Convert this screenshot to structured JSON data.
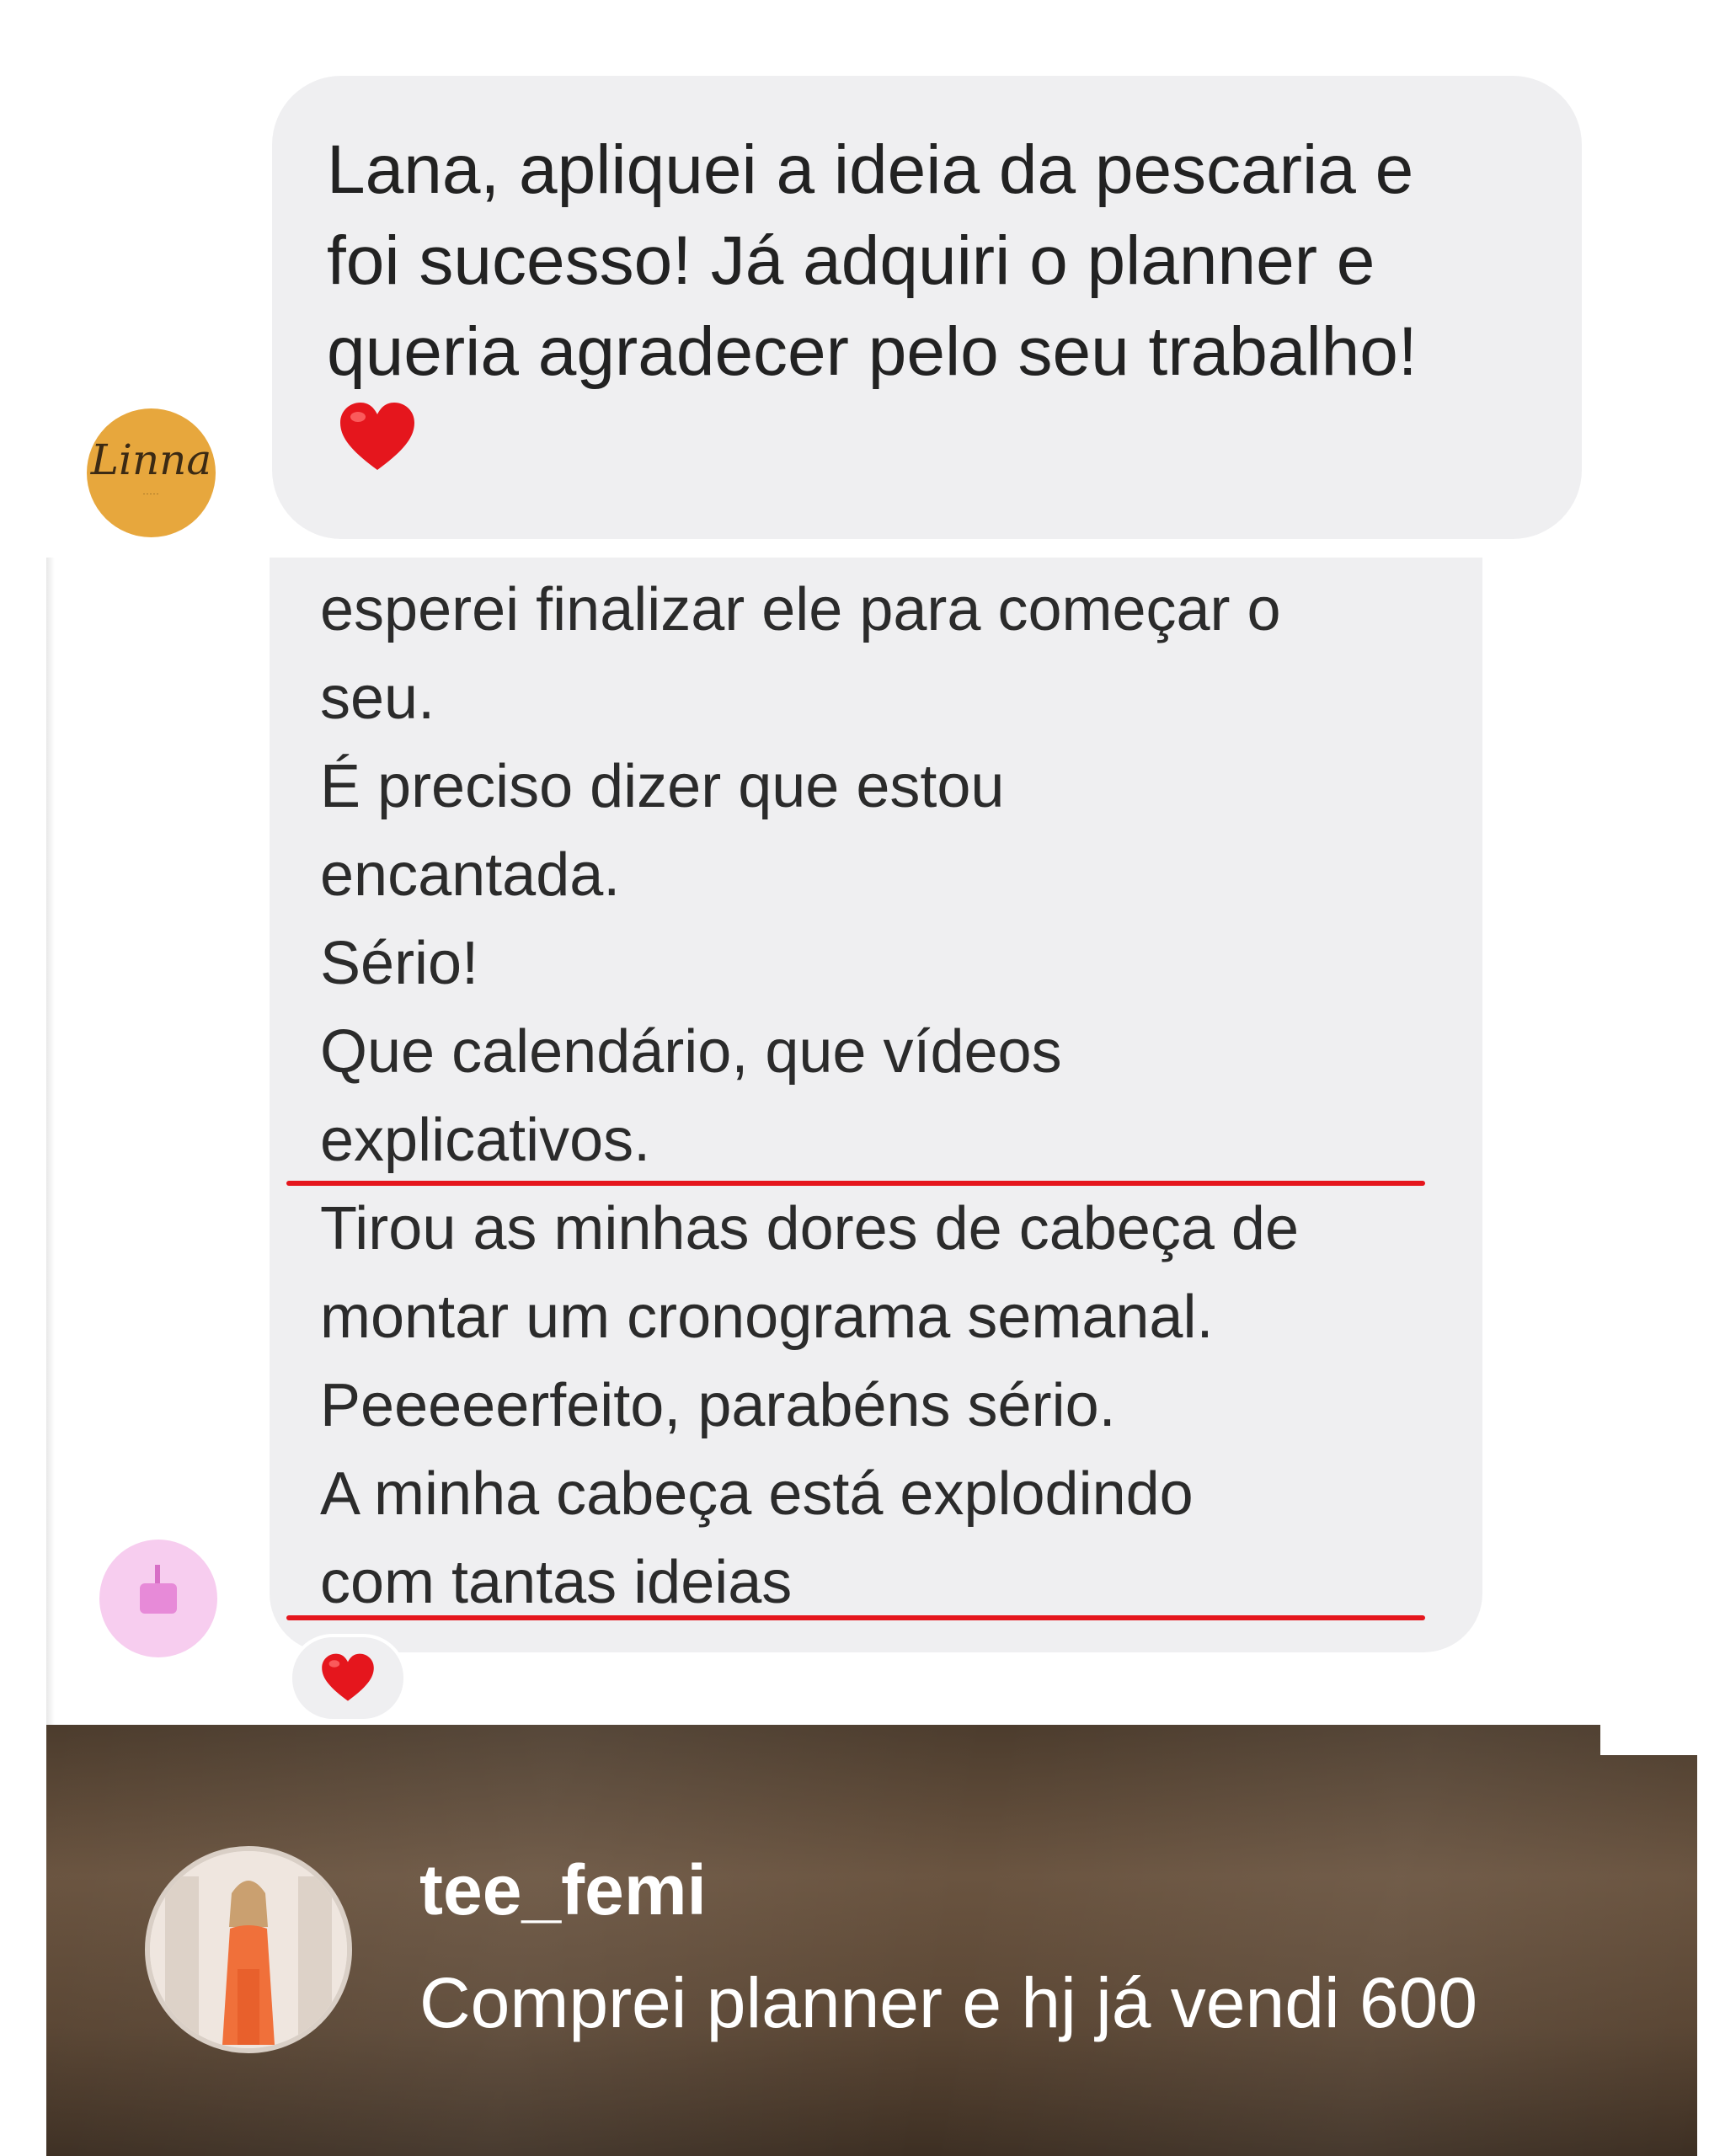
{
  "message1": {
    "lines": [
      "Lana, apliquei a ideia da pescaria e",
      "foi sucesso! Já adquiri o planner e",
      "queria agradecer pelo seu trabalho!"
    ],
    "avatar_text": "Linna",
    "emoji": "heart-emoji"
  },
  "message2": {
    "lines": [
      "esperei finalizar ele para começar o",
      "seu.",
      "É preciso dizer que estou",
      "encantada.",
      "Sério!",
      "Que calendário, que vídeos",
      "explicativos.",
      "Tirou as minhas dores de cabeça de",
      "montar um cronograma semanal.",
      "Peeeeerfeito, parabéns sério.",
      "A minha cabeça está explodindo",
      "com tantas ideias"
    ],
    "reaction": "heart-emoji",
    "highlight_color": "#e5161d"
  },
  "story_reply": {
    "username": "tee_femi",
    "comment": "Comprei planner e hj já vendi 600"
  }
}
